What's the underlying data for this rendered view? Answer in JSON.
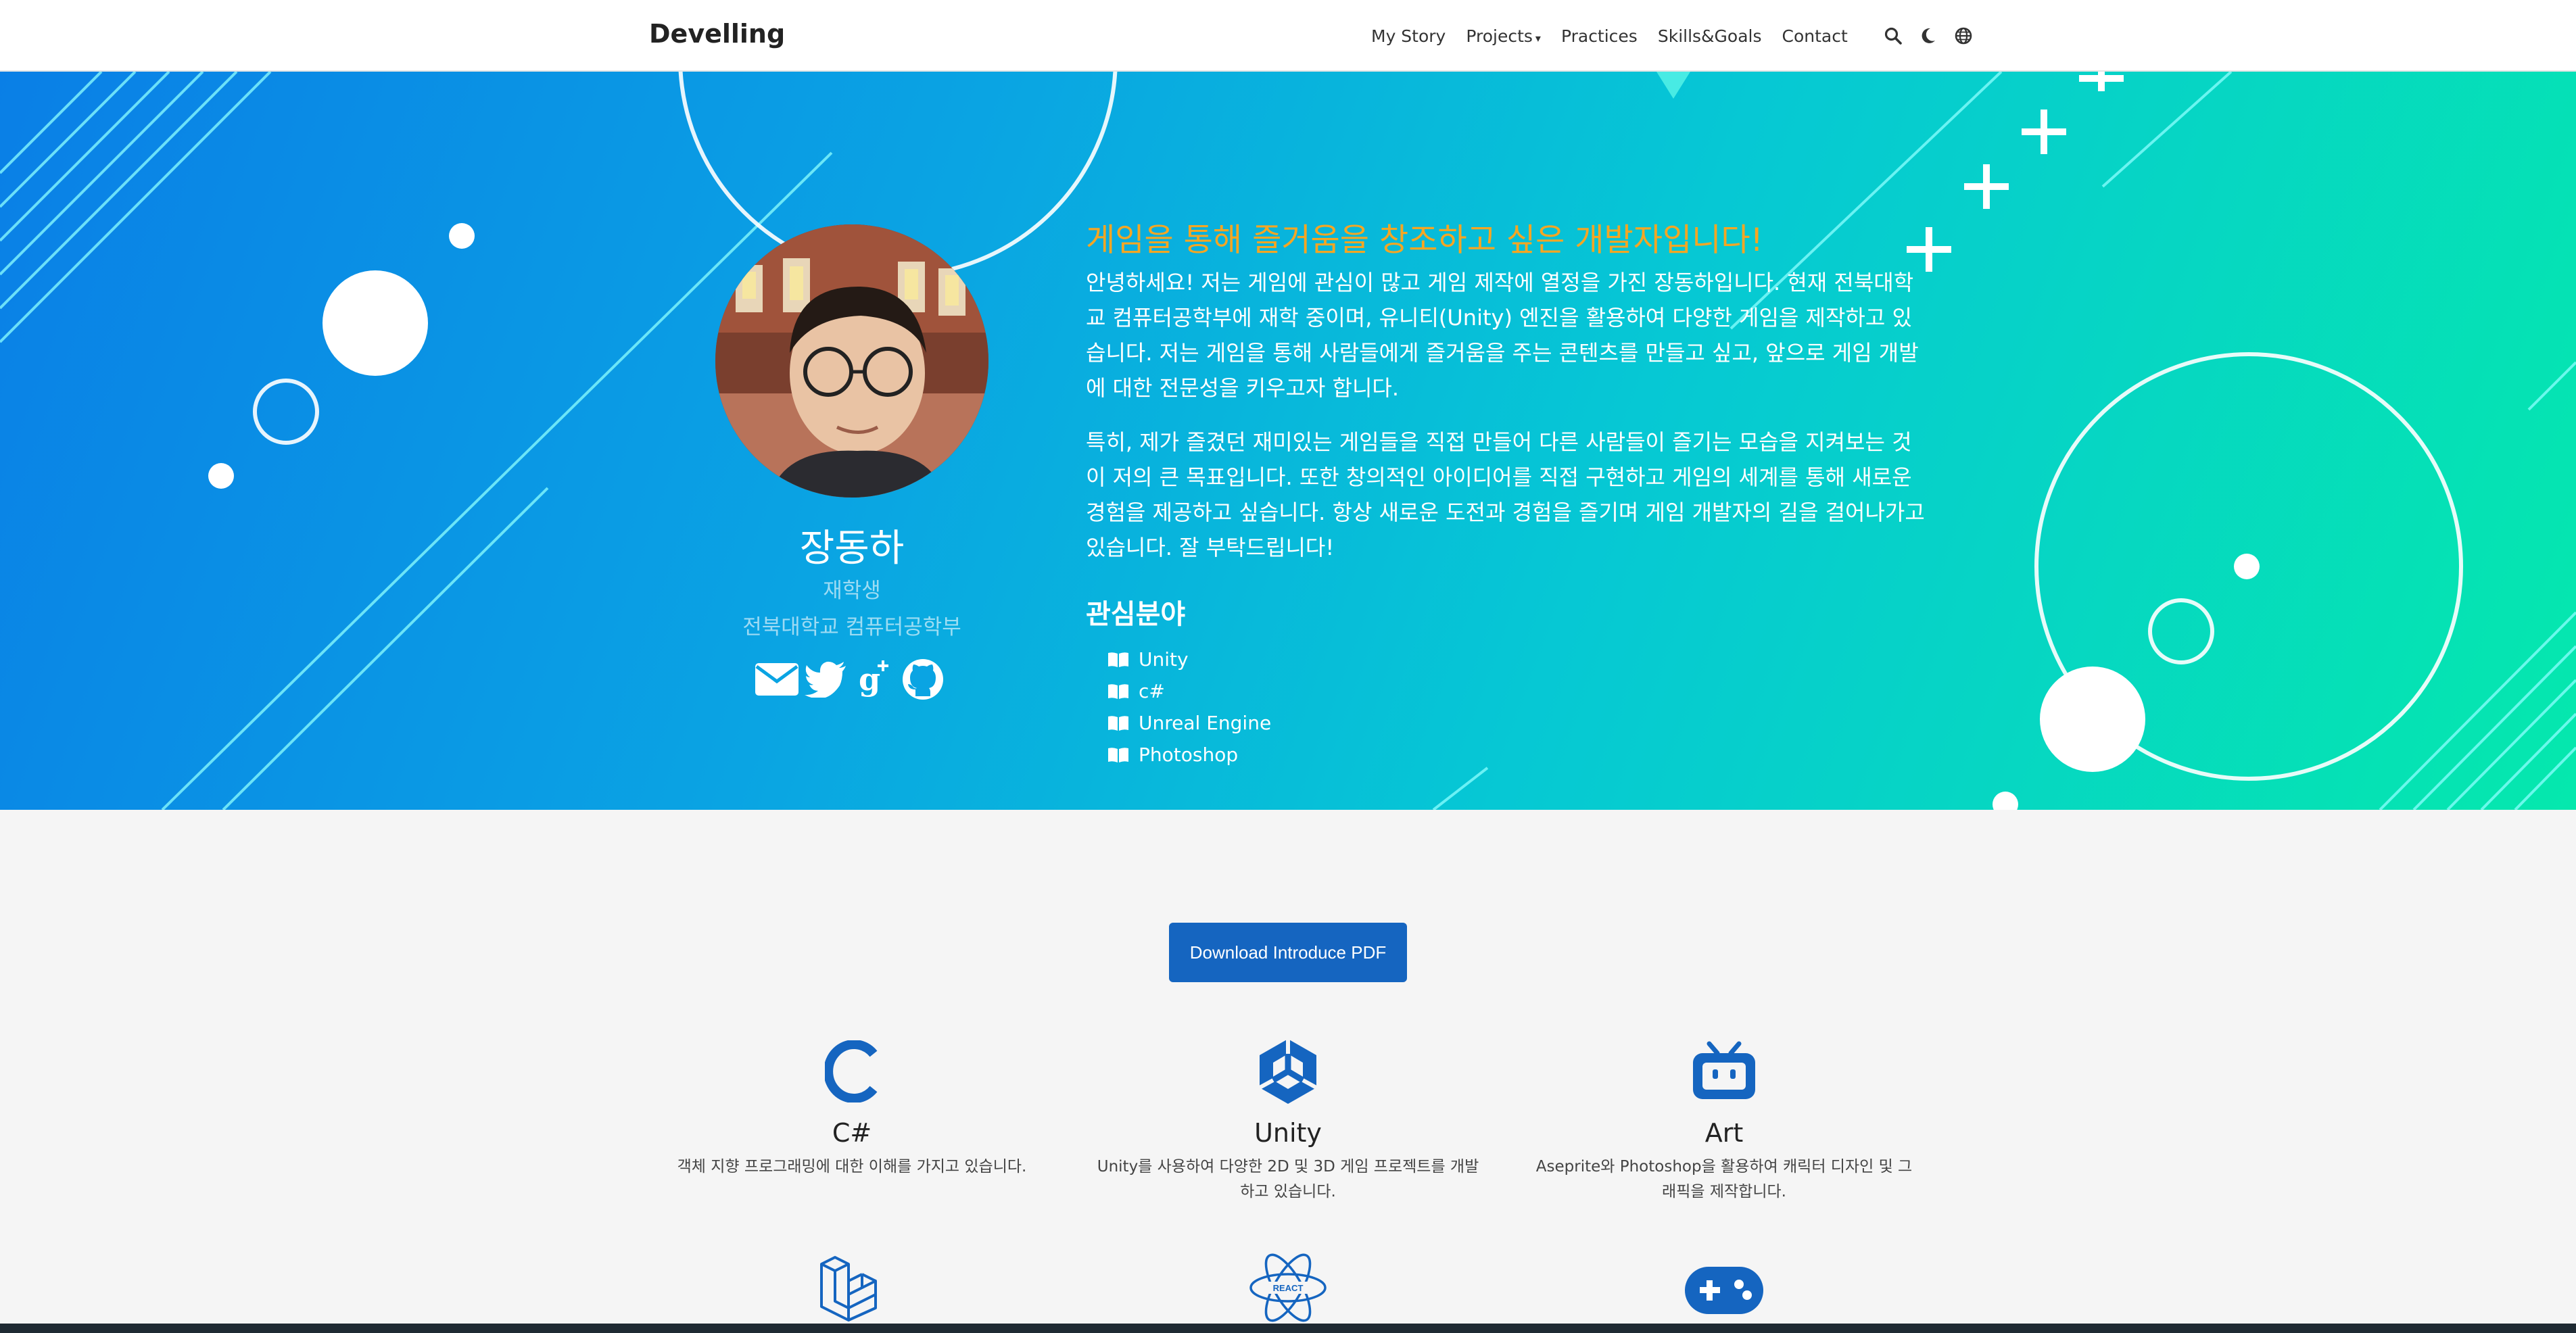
{
  "nav": {
    "brand": "Develling",
    "links": [
      {
        "label": "My Story"
      },
      {
        "label": "Projects",
        "caret": "▾"
      },
      {
        "label": "Practices"
      },
      {
        "label": "Skills&Goals"
      },
      {
        "label": "Contact"
      }
    ],
    "icons": [
      "search-icon",
      "moon-icon",
      "globe-icon"
    ]
  },
  "profile": {
    "name": "장동하",
    "role": "재학생",
    "school": "전북대학교 컴퓨터공학부",
    "socials": [
      "envelope-icon",
      "twitter-icon",
      "google-plus-icon",
      "github-icon"
    ]
  },
  "intro": {
    "headline": "게임을 통해 즐거움을 창조하고 싶은 개발자입니다!",
    "paragraph1": "안녕하세요! 저는 게임에 관심이 많고 게임 제작에 열정을 가진 장동하입니다. 현재 전북대학교 컴퓨터공학부에 재학 중이며, 유니티(Unity) 엔진을 활용하여 다양한 게임을 제작하고 있습니다. 저는 게임을 통해 사람들에게 즐거움을 주는 콘텐츠를 만들고 싶고, 앞으로 게임 개발에 대한 전문성을 키우고자 합니다.",
    "paragraph2": "특히, 제가 즐겼던 재미있는 게임들을 직접 만들어 다른 사람들이 즐기는 모습을 지켜보는 것이 저의 큰 목표입니다. 또한 창의적인 아이디어를 직접 구현하고 게임의 세계를 통해 새로운 경험을 제공하고 싶습니다. 항상 새로운 도전과 경험을 즐기며 게임 개발자의 길을 걸어나가고 있습니다. 잘 부탁드립니다!",
    "interests_title": "관심분야",
    "interests": [
      "Unity",
      "c#",
      "Unreal Engine",
      "Photoshop"
    ]
  },
  "download_label": "Download Introduce PDF",
  "skills": [
    {
      "icon": "csharp-c-icon",
      "title": "C#",
      "desc": "객체 지향 프로그래밍에 대한 이해를 가지고 있습니다."
    },
    {
      "icon": "unity-icon",
      "title": "Unity",
      "desc": "Unity를 사용하여 다양한 2D 및 3D 게임 프로젝트를 개발하고 있습니다."
    },
    {
      "icon": "tv-robot-icon",
      "title": "Art",
      "desc": "Aseprite와 Photoshop을 활용하여 캐릭터 디자인 및 그래픽을 제작합니다."
    }
  ],
  "skills_row2": [
    {
      "icon": "laravel-icon"
    },
    {
      "icon": "react-icon",
      "label": "REACT"
    },
    {
      "icon": "gamepad-icon"
    }
  ],
  "colors": {
    "accent": "#1565c0",
    "headline": "#f5a623",
    "hero_start": "#0a7fe6",
    "hero_end": "#05e8ad"
  }
}
